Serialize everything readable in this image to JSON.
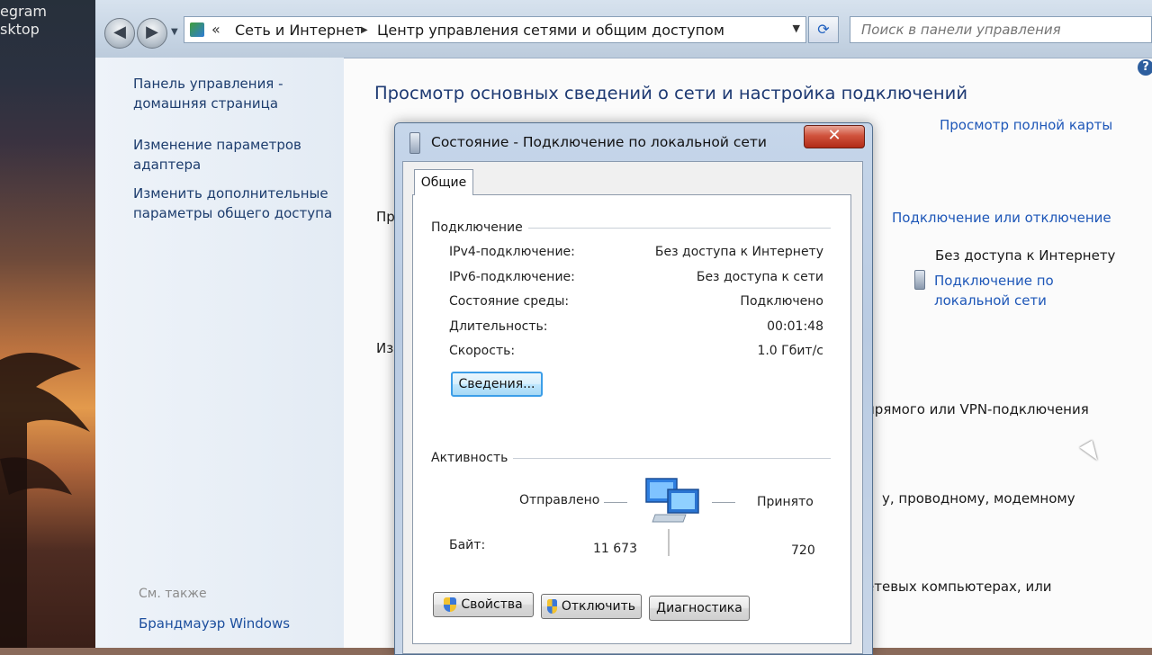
{
  "desktop": {
    "texts": [
      "egram",
      "sktop"
    ]
  },
  "explorer": {
    "back_glyph": "◀",
    "forward_glyph": "▶",
    "address": {
      "chevron": "«",
      "separator": "▶",
      "parts": [
        "Сеть и Интернет",
        "Центр управления сетями и общим доступом"
      ]
    },
    "search_placeholder": "Поиск в панели управления",
    "help_glyph": "?"
  },
  "left_pane": {
    "links": [
      "Панель управления - домашняя страница",
      "Изменение параметров адаптера",
      "Изменить дополнительные параметры общего доступа"
    ],
    "see_also": "См. также",
    "firewall": "Брандмауэр Windows"
  },
  "main": {
    "title": "Просмотр основных сведений о сети и настройка подключений",
    "full_map": "Просмотр полной карты",
    "connect_disconnect": "Подключение или отключение",
    "access_type": "Без доступа к Интернету",
    "connection_link": "Подключение по локальной сети",
    "partial_1": "Пр",
    "partial_2": "Из",
    "partial_3": "прямого или VPN-подключения",
    "partial_4": "у, проводному, модемному",
    "partial_5": "етевых компьютерах, или"
  },
  "dialog": {
    "title": "Состояние - Подключение по локальной сети",
    "close_glyph": "✕",
    "tab": "Общие",
    "connection_group": "Подключение",
    "rows": [
      {
        "label": "IPv4-подключение:",
        "value": "Без доступа к Интернету"
      },
      {
        "label": "IPv6-подключение:",
        "value": "Без доступа к сети"
      },
      {
        "label": "Состояние среды:",
        "value": "Подключено"
      },
      {
        "label": "Длительность:",
        "value": "00:01:48"
      },
      {
        "label": "Скорость:",
        "value": "1.0 Гбит/с"
      }
    ],
    "details_button": "Сведения...",
    "activity_group": "Активность",
    "sent_label": "Отправлено",
    "received_label": "Принято",
    "bytes_label": "Байт:",
    "bytes_sent": "11 673",
    "bytes_received": "720",
    "properties_button": "Свойства",
    "disable_button": "Отключить",
    "diagnose_button": "Диагностика"
  },
  "colors": {
    "link": "#1e57b8",
    "title": "#1e3a73",
    "close_red": "#c8402a",
    "focus_blue": "#3c9ee8"
  }
}
